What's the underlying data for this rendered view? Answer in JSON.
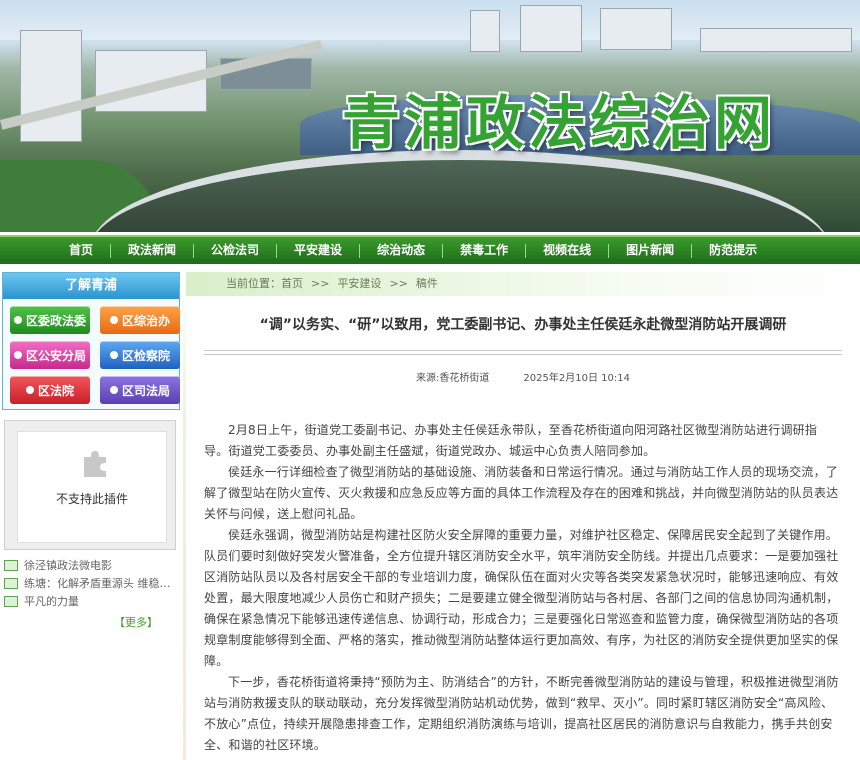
{
  "header": {
    "site_title": "青浦政法综治网"
  },
  "nav": {
    "items": [
      "首页",
      "政法新闻",
      "公检法司",
      "平安建设",
      "综治动态",
      "禁毒工作",
      "视频在线",
      "图片新闻",
      "防范提示"
    ]
  },
  "sidebar": {
    "section_title": "了解青浦",
    "tiles": [
      "区委政法委",
      "区综治办",
      "区公安分局",
      "区检察院",
      "区法院",
      "区司法局"
    ],
    "plugin_text": "不支持此插件",
    "news": [
      "徐泾镇政法微电影",
      "练塘：化解矛盾重源头 维稳关…",
      "平凡的力量"
    ],
    "more": "【更多】"
  },
  "breadcrumb": {
    "label": "当前位置：",
    "items": [
      "首页",
      "平安建设",
      "稿件"
    ],
    "sep": ">>"
  },
  "article": {
    "title": "“调”以务实、“研”以致用，党工委副书记、办事处主任侯廷永赴微型消防站开展调研",
    "source": "来源:香花桥街道",
    "date": "2025年2月10日  10:14",
    "paragraphs": [
      "2月8日上午，街道党工委副书记、办事处主任侯廷永带队，至香花桥街道向阳河路社区微型消防站进行调研指导。街道党工委委员、办事处副主任盛斌，街道党政办、城运中心负责人陪同参加。",
      "侯廷永一行详细检查了微型消防站的基础设施、消防装备和日常运行情况。通过与消防站工作人员的现场交流，了解了微型站在防火宣传、灭火救援和应急反应等方面的具体工作流程及存在的困难和挑战，并向微型消防站的队员表达关怀与问候，送上慰问礼品。",
      "侯廷永强调，微型消防站是构建社区防火安全屏障的重要力量，对维护社区稳定、保障居民安全起到了关键作用。队员们要时刻做好突发火警准备，全方位提升辖区消防安全水平，筑牢消防安全防线。并提出几点要求：一是要加强社区消防站队员以及各村居安全干部的专业培训力度，确保队伍在面对火灾等各类突发紧急状况时，能够迅速响应、有效处置，最大限度地减少人员伤亡和财产损失；二是要建立健全微型消防站与各村居、各部门之间的信息协同沟通机制，确保在紧急情况下能够迅速传递信息、协调行动，形成合力；三是要强化日常巡查和监管力度，确保微型消防站的各项规章制度能够得到全面、严格的落实，推动微型消防站整体运行更加高效、有序，为社区的消防安全提供更加坚实的保障。",
      "下一步，香花桥街道将秉持“预防为主、防消结合”的方针，不断完善微型消防站的建设与管理，积极推进微型消防站与消防救援支队的联动联动，充分发挥微型消防站机动优势，做到“救早、灭小”。同时紧盯辖区消防安全“高风险、不放心”点位，持续开展隐患排查工作，定期组织消防演练与培训，提高社区居民的消防意识与自救能力，携手共创安全、和谐的社区环境。"
    ]
  }
}
